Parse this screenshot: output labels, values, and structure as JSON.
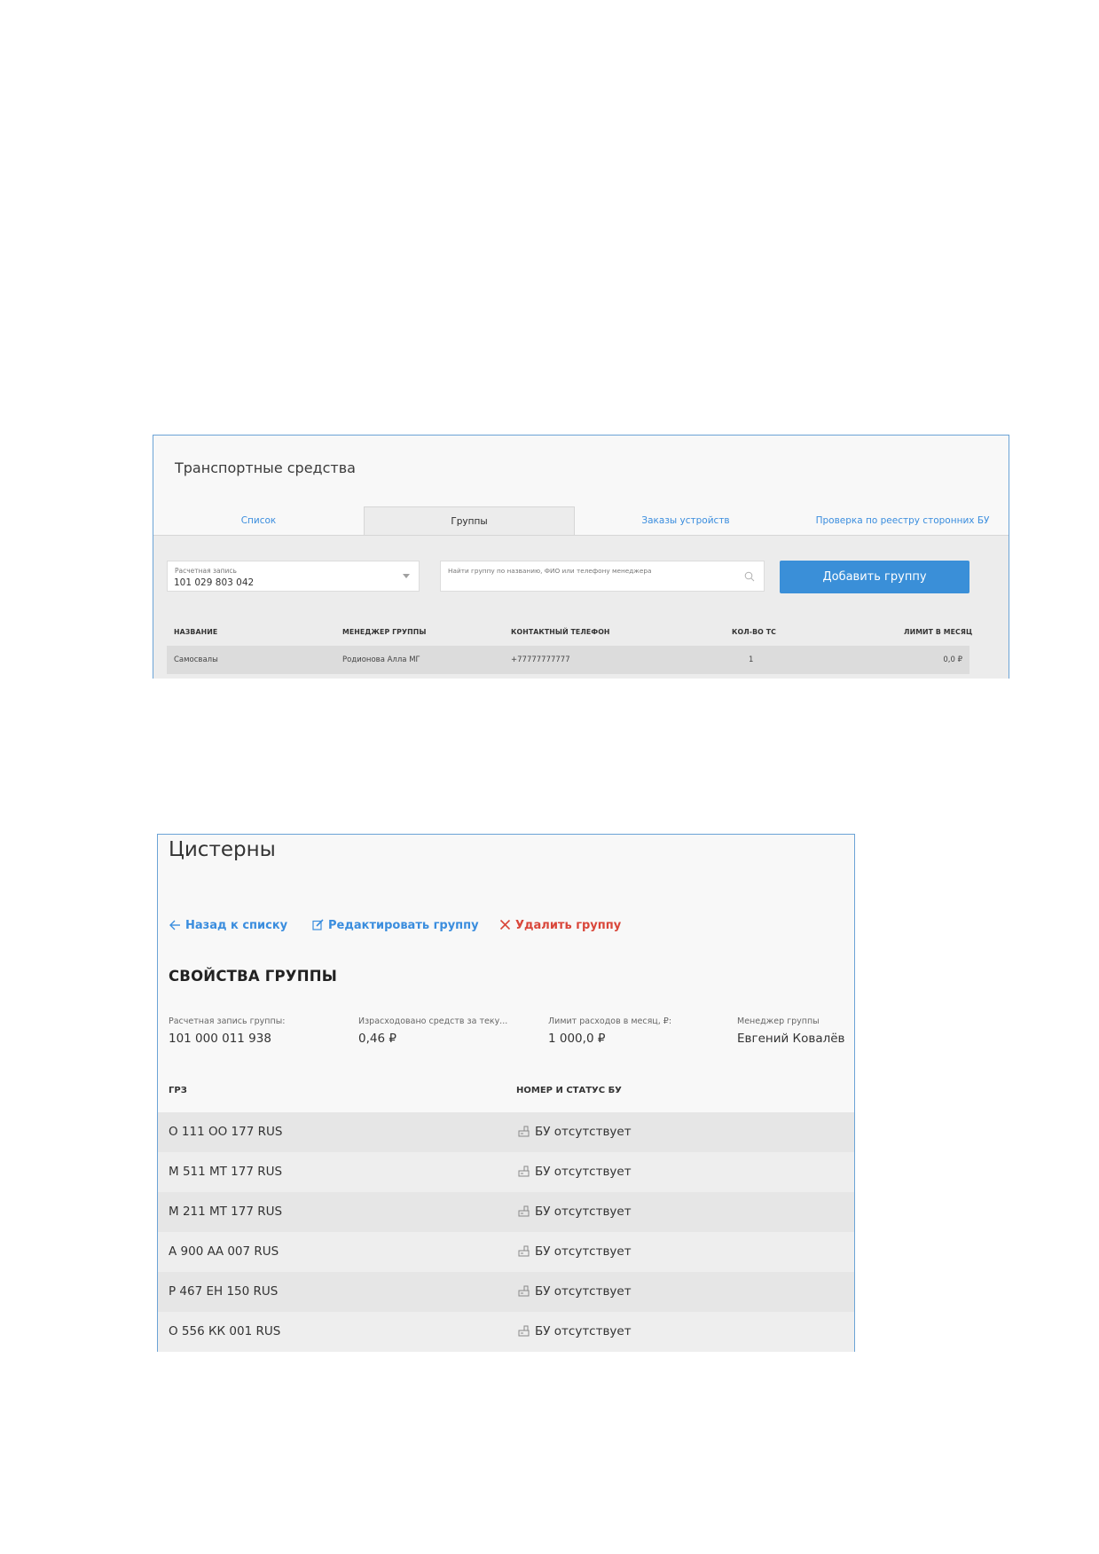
{
  "panel1": {
    "title": "Транспортные средства",
    "tabs": [
      {
        "label": "Список",
        "active": false
      },
      {
        "label": "Группы",
        "active": true
      },
      {
        "label": "Заказы устройств",
        "active": false
      },
      {
        "label": "Проверка по реестру сторонних БУ",
        "active": false
      }
    ],
    "account_select": {
      "label": "Расчетная запись",
      "value": "101 029 803 042"
    },
    "search": {
      "placeholder": "Найти группу по названию, ФИО или телефону менеджера",
      "icon": "search-icon"
    },
    "add_button": "Добавить группу",
    "colors": {
      "accent": "#3a8fd8",
      "link": "#3a8dde"
    },
    "table": {
      "headers": [
        "НАЗВАНИЕ",
        "МЕНЕДЖЕР ГРУППЫ",
        "КОНТАКТНЫЙ ТЕЛЕФОН",
        "КОЛ-ВО ТС",
        "ЛИМИТ В МЕСЯЦ"
      ],
      "rows": [
        [
          "Самосвалы",
          "Родионова Алла МГ",
          "+77777777777",
          "1",
          "0,0 ₽"
        ]
      ]
    }
  },
  "panel2": {
    "title": "Цистерны",
    "actions": {
      "back": "Назад к списку",
      "edit": "Редактировать группу",
      "delete": "Удалить группу"
    },
    "props_title": "СВОЙСТВА ГРУППЫ",
    "props": [
      {
        "label": "Расчетная запись группы:",
        "value": "101 000 011 938"
      },
      {
        "label": "Израсходовано средств за теку...",
        "value": "0,46 ₽"
      },
      {
        "label": "Лимит расходов в месяц, ₽:",
        "value": "1 000,0 ₽"
      },
      {
        "label": "Менеджер группы",
        "value": "Евгений Ковалёв"
      }
    ],
    "columns": [
      "ГРЗ",
      "НОМЕР И СТАТУС БУ"
    ],
    "vehicles": [
      {
        "plate": "О 111 ОО 177 RUS",
        "status": "БУ отсутствует"
      },
      {
        "plate": "М 511 МТ 177 RUS",
        "status": "БУ отсутствует"
      },
      {
        "plate": "М 211 МТ 177 RUS",
        "status": "БУ отсутствует"
      },
      {
        "plate": "А 900 АА 007 RUS",
        "status": "БУ отсутствует"
      },
      {
        "plate": "Р 467 ЕН 150 RUS",
        "status": "БУ отсутствует"
      },
      {
        "plate": "О 556 КК 001 RUS",
        "status": "БУ отсутствует"
      }
    ],
    "colors": {
      "link": "#3a8dde",
      "danger": "#d9463a"
    }
  }
}
